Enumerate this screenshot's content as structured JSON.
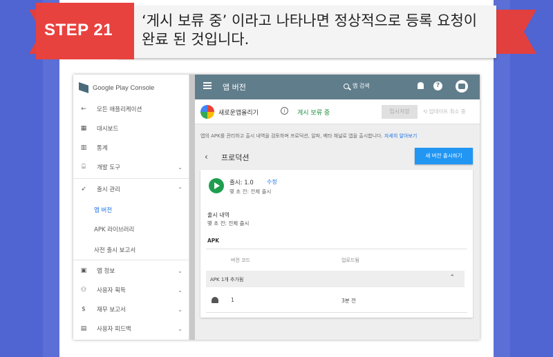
{
  "banner": {
    "step_label": "STEP 21",
    "text_line1": "‘게시 보류 중’ 이라고 나타나면 정상적으로 등록 요청이",
    "text_line2": "완료 된 것입니다."
  },
  "sidebar": {
    "logo_text": "Google Play Console",
    "items": [
      {
        "label": "모든 애플리케이션",
        "icon": "arrow-left-icon"
      },
      {
        "label": "대시보드",
        "icon": "dashboard-icon"
      },
      {
        "label": "통계",
        "icon": "stats-icon"
      },
      {
        "label": "개발 도구",
        "icon": "dev-tools-icon"
      },
      {
        "label": "출시 관리",
        "icon": "rocket-icon"
      },
      {
        "label": "앱 정보",
        "icon": "store-icon"
      },
      {
        "label": "사용자 획득",
        "icon": "user-add-icon"
      },
      {
        "label": "재무 보고서",
        "icon": "dollar-icon"
      },
      {
        "label": "사용자 피드백",
        "icon": "feedback-icon"
      }
    ],
    "sub_items": [
      "앱 버전",
      "APK 라이브러리",
      "사전 출시 보고서"
    ]
  },
  "topbar": {
    "title": "앱 버전",
    "search_placeholder": "앱 검색"
  },
  "appbar": {
    "app_name": "새로운앱올리기",
    "status": "게시 보류 중",
    "save_label": "임시저장",
    "discard_label": "업데이트 취소 중"
  },
  "main": {
    "description": "앱의 APK를 관리하고 출시 내역을 검토하며 프로덕션, 알파, 베타 채널로 앱을 출시합니다.",
    "learn_more": "자세히 알아보기",
    "track_title": "프로덕션",
    "new_release_button": "새 버전 출시하기",
    "release": {
      "name": "출시: 1.0",
      "edit_label": "수정",
      "time": "몇 초 전: 전체 출시"
    },
    "history": {
      "title": "출시 내역",
      "time": "몇 초 전: 전체 출시"
    },
    "apk_label": "APK",
    "columns": [
      "버전 코드",
      "업로드됨"
    ],
    "group_label": "APK 1개 추가됨",
    "rows": [
      {
        "version_code": "1",
        "uploaded": "3분 전"
      }
    ]
  },
  "colors": {
    "ribbon": "#e2403e",
    "topbar": "#607d8b",
    "primary_button": "#2196f3",
    "status_green": "#1e8e3e",
    "link_blue": "#1a73e8",
    "background": "#5b6fd6"
  }
}
